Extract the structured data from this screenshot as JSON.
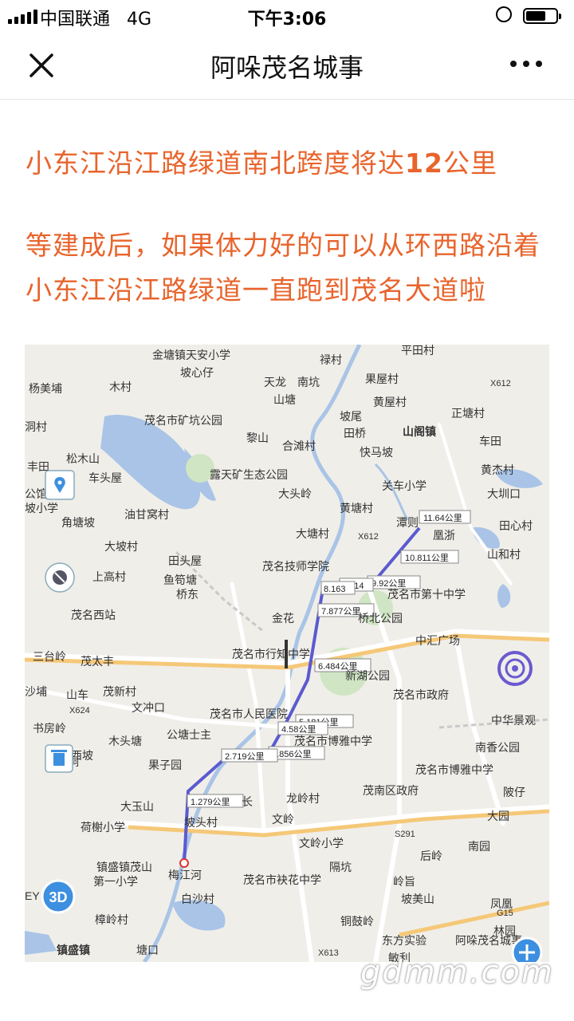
{
  "status_bar": {
    "carrier": "中国联通",
    "network": "4G",
    "time": "下午3:06"
  },
  "nav": {
    "title": "阿哚茂名城事"
  },
  "article": {
    "headline_prefix": "小东江沿江路绿道南北跨度将达",
    "headline_number": "12",
    "headline_suffix": "公里",
    "paragraph": "等建成后，如果体力好的可以从环西路沿着小东江沿江路绿道一直跑到茂名大道啦"
  },
  "map": {
    "colors": {
      "route": "#5a5ad0",
      "land": "#f0eee9",
      "water": "#a9c4e6",
      "park": "#cfe5c3",
      "road": "#ffffff",
      "highway": "#f5c878"
    },
    "places": [
      {
        "id": "p1",
        "text": "金塘镇天安小学"
      },
      {
        "id": "p2",
        "text": "禄村"
      },
      {
        "id": "p3",
        "text": "平田村"
      },
      {
        "id": "p4",
        "text": "坡心仔"
      },
      {
        "id": "p5",
        "text": "天龙"
      },
      {
        "id": "p6",
        "text": "南坑"
      },
      {
        "id": "p7",
        "text": "果屋村"
      },
      {
        "id": "p8",
        "text": "杨美埔"
      },
      {
        "id": "p9",
        "text": "木村"
      },
      {
        "id": "p10",
        "text": "山塘"
      },
      {
        "id": "p11",
        "text": "黄屋村"
      },
      {
        "id": "p12",
        "text": "X612"
      },
      {
        "id": "p13",
        "text": "茂名市矿坑公园"
      },
      {
        "id": "p14",
        "text": "坡尾"
      },
      {
        "id": "p15",
        "text": "正塘村"
      },
      {
        "id": "p16",
        "text": "洞村"
      },
      {
        "id": "p17",
        "text": "黎山"
      },
      {
        "id": "p18",
        "text": "合滩村"
      },
      {
        "id": "p19",
        "text": "田桥"
      },
      {
        "id": "p20",
        "text": "山阁镇"
      },
      {
        "id": "p21",
        "text": "车田"
      },
      {
        "id": "p22",
        "text": "快马坡"
      },
      {
        "id": "p23",
        "text": "松木山"
      },
      {
        "id": "p24",
        "text": "丰田"
      },
      {
        "id": "p25",
        "text": "车头屋"
      },
      {
        "id": "p26",
        "text": "露天矿生态公园"
      },
      {
        "id": "p27",
        "text": "黄杰村"
      },
      {
        "id": "p28",
        "text": "公馆"
      },
      {
        "id": "p29",
        "text": "坡小学"
      },
      {
        "id": "p30",
        "text": "大头岭"
      },
      {
        "id": "p31",
        "text": "关车小学"
      },
      {
        "id": "p32",
        "text": "大圳口"
      },
      {
        "id": "p33",
        "text": "角塘坡"
      },
      {
        "id": "p34",
        "text": "油甘窝村"
      },
      {
        "id": "p35",
        "text": "黄塘村"
      },
      {
        "id": "p36",
        "text": "潭则"
      },
      {
        "id": "p37",
        "text": "田心村"
      },
      {
        "id": "p38",
        "text": "X612"
      },
      {
        "id": "p39",
        "text": "大塘村"
      },
      {
        "id": "p40",
        "text": "凰浙"
      },
      {
        "id": "p41",
        "text": "大坡村"
      },
      {
        "id": "p42",
        "text": "田头屋"
      },
      {
        "id": "p43",
        "text": "山和村"
      },
      {
        "id": "p44",
        "text": "茂名技师学院"
      },
      {
        "id": "p45",
        "text": "上高村"
      },
      {
        "id": "p46",
        "text": "鱼笱塘"
      },
      {
        "id": "p47",
        "text": "桥东"
      },
      {
        "id": "p48",
        "text": "茂名市第十中学"
      },
      {
        "id": "p49",
        "text": "茂名西站"
      },
      {
        "id": "p50",
        "text": "金花"
      },
      {
        "id": "p51",
        "text": "桥北公园"
      },
      {
        "id": "p52",
        "text": "中汇广场"
      },
      {
        "id": "p53",
        "text": "三台岭"
      },
      {
        "id": "p54",
        "text": "茂太丰"
      },
      {
        "id": "p55",
        "text": "茂名市行知中学"
      },
      {
        "id": "p56",
        "text": "新湖公园"
      },
      {
        "id": "p57",
        "text": "沙埔"
      },
      {
        "id": "p58",
        "text": "山车"
      },
      {
        "id": "p59",
        "text": "茂新村"
      },
      {
        "id": "p60",
        "text": "茂名市政府"
      },
      {
        "id": "p61",
        "text": "X624"
      },
      {
        "id": "p62",
        "text": "文冲口"
      },
      {
        "id": "p63",
        "text": "书房岭"
      },
      {
        "id": "p64",
        "text": "茂名市人民医院"
      },
      {
        "id": "p65",
        "text": "中华景观"
      },
      {
        "id": "p66",
        "text": "公塘士主"
      },
      {
        "id": "p67",
        "text": "木头塘"
      },
      {
        "id": "p68",
        "text": "茂名市博雅中学"
      },
      {
        "id": "p69",
        "text": "南香公园"
      },
      {
        "id": "p70",
        "text": "西坡"
      },
      {
        "id": "p71",
        "text": "那梭垌"
      },
      {
        "id": "p72",
        "text": "果子园"
      },
      {
        "id": "p73",
        "text": "茂名市博雅中学"
      },
      {
        "id": "p74",
        "text": "陂仔"
      },
      {
        "id": "p75",
        "text": "龙岭村"
      },
      {
        "id": "p76",
        "text": "茂南区政府"
      },
      {
        "id": "p77",
        "text": "大玉山"
      },
      {
        "id": "p78",
        "text": "长"
      },
      {
        "id": "p79",
        "text": "荷榭小学"
      },
      {
        "id": "p80",
        "text": "坡头村"
      },
      {
        "id": "p81",
        "text": "文岭"
      },
      {
        "id": "p82",
        "text": "大园"
      },
      {
        "id": "p83",
        "text": "S291"
      },
      {
        "id": "p84",
        "text": "文岭小学"
      },
      {
        "id": "p85",
        "text": "南园"
      },
      {
        "id": "p86",
        "text": "镇盛镇茂山"
      },
      {
        "id": "p87",
        "text": "第一小学"
      },
      {
        "id": "p88",
        "text": "梅江河"
      },
      {
        "id": "p89",
        "text": "隔坑"
      },
      {
        "id": "p90",
        "text": "后岭"
      },
      {
        "id": "p91",
        "text": "EY"
      },
      {
        "id": "p92",
        "text": "茂名市袂花中学"
      },
      {
        "id": "p93",
        "text": "岭旨"
      },
      {
        "id": "p94",
        "text": "凤凰"
      },
      {
        "id": "p95",
        "text": "白沙村"
      },
      {
        "id": "p96",
        "text": "坡美山"
      },
      {
        "id": "p97",
        "text": "G15"
      },
      {
        "id": "p98",
        "text": "樟岭村"
      },
      {
        "id": "p99",
        "text": "铜鼓岭"
      },
      {
        "id": "p100",
        "text": "林园"
      },
      {
        "id": "p101",
        "text": "镇盛镇"
      },
      {
        "id": "p102",
        "text": "塘口"
      },
      {
        "id": "p103",
        "text": "X613"
      },
      {
        "id": "p104",
        "text": "东方实验"
      },
      {
        "id": "p105",
        "text": "敏利"
      }
    ],
    "distances": [
      {
        "id": "d1",
        "text": "11.64公里"
      },
      {
        "id": "d2",
        "text": "10.811公里"
      },
      {
        "id": "d3",
        "text": "9.92公里"
      },
      {
        "id": "d4",
        "text": "9.314"
      },
      {
        "id": "d5",
        "text": "8.163"
      },
      {
        "id": "d6",
        "text": "7.877公里"
      },
      {
        "id": "d7",
        "text": "6.484公里"
      },
      {
        "id": "d8",
        "text": "5.181公里"
      },
      {
        "id": "d9",
        "text": "4.58公里"
      },
      {
        "id": "d10",
        "text": "3.856公里"
      },
      {
        "id": "d11",
        "text": "2.719公里"
      },
      {
        "id": "d12",
        "text": "1.279公里"
      }
    ],
    "controls": {
      "three_d_label": "3D",
      "map_watermark": "阿哚茂名城事"
    }
  },
  "watermark": "gdmm.com"
}
